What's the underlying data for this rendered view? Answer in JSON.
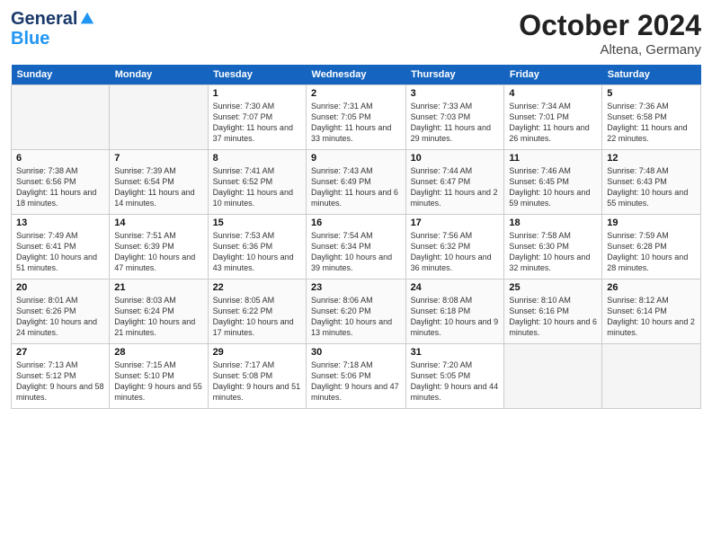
{
  "header": {
    "title": "October 2024",
    "location": "Altena, Germany",
    "logo_line1": "General",
    "logo_line2": "Blue"
  },
  "days_of_week": [
    "Sunday",
    "Monday",
    "Tuesday",
    "Wednesday",
    "Thursday",
    "Friday",
    "Saturday"
  ],
  "weeks": [
    [
      {
        "day": "",
        "empty": true
      },
      {
        "day": "",
        "empty": true
      },
      {
        "day": "1",
        "sunrise": "Sunrise: 7:30 AM",
        "sunset": "Sunset: 7:07 PM",
        "daylight": "Daylight: 11 hours and 37 minutes."
      },
      {
        "day": "2",
        "sunrise": "Sunrise: 7:31 AM",
        "sunset": "Sunset: 7:05 PM",
        "daylight": "Daylight: 11 hours and 33 minutes."
      },
      {
        "day": "3",
        "sunrise": "Sunrise: 7:33 AM",
        "sunset": "Sunset: 7:03 PM",
        "daylight": "Daylight: 11 hours and 29 minutes."
      },
      {
        "day": "4",
        "sunrise": "Sunrise: 7:34 AM",
        "sunset": "Sunset: 7:01 PM",
        "daylight": "Daylight: 11 hours and 26 minutes."
      },
      {
        "day": "5",
        "sunrise": "Sunrise: 7:36 AM",
        "sunset": "Sunset: 6:58 PM",
        "daylight": "Daylight: 11 hours and 22 minutes."
      }
    ],
    [
      {
        "day": "6",
        "sunrise": "Sunrise: 7:38 AM",
        "sunset": "Sunset: 6:56 PM",
        "daylight": "Daylight: 11 hours and 18 minutes."
      },
      {
        "day": "7",
        "sunrise": "Sunrise: 7:39 AM",
        "sunset": "Sunset: 6:54 PM",
        "daylight": "Daylight: 11 hours and 14 minutes."
      },
      {
        "day": "8",
        "sunrise": "Sunrise: 7:41 AM",
        "sunset": "Sunset: 6:52 PM",
        "daylight": "Daylight: 11 hours and 10 minutes."
      },
      {
        "day": "9",
        "sunrise": "Sunrise: 7:43 AM",
        "sunset": "Sunset: 6:49 PM",
        "daylight": "Daylight: 11 hours and 6 minutes."
      },
      {
        "day": "10",
        "sunrise": "Sunrise: 7:44 AM",
        "sunset": "Sunset: 6:47 PM",
        "daylight": "Daylight: 11 hours and 2 minutes."
      },
      {
        "day": "11",
        "sunrise": "Sunrise: 7:46 AM",
        "sunset": "Sunset: 6:45 PM",
        "daylight": "Daylight: 10 hours and 59 minutes."
      },
      {
        "day": "12",
        "sunrise": "Sunrise: 7:48 AM",
        "sunset": "Sunset: 6:43 PM",
        "daylight": "Daylight: 10 hours and 55 minutes."
      }
    ],
    [
      {
        "day": "13",
        "sunrise": "Sunrise: 7:49 AM",
        "sunset": "Sunset: 6:41 PM",
        "daylight": "Daylight: 10 hours and 51 minutes."
      },
      {
        "day": "14",
        "sunrise": "Sunrise: 7:51 AM",
        "sunset": "Sunset: 6:39 PM",
        "daylight": "Daylight: 10 hours and 47 minutes."
      },
      {
        "day": "15",
        "sunrise": "Sunrise: 7:53 AM",
        "sunset": "Sunset: 6:36 PM",
        "daylight": "Daylight: 10 hours and 43 minutes."
      },
      {
        "day": "16",
        "sunrise": "Sunrise: 7:54 AM",
        "sunset": "Sunset: 6:34 PM",
        "daylight": "Daylight: 10 hours and 39 minutes."
      },
      {
        "day": "17",
        "sunrise": "Sunrise: 7:56 AM",
        "sunset": "Sunset: 6:32 PM",
        "daylight": "Daylight: 10 hours and 36 minutes."
      },
      {
        "day": "18",
        "sunrise": "Sunrise: 7:58 AM",
        "sunset": "Sunset: 6:30 PM",
        "daylight": "Daylight: 10 hours and 32 minutes."
      },
      {
        "day": "19",
        "sunrise": "Sunrise: 7:59 AM",
        "sunset": "Sunset: 6:28 PM",
        "daylight": "Daylight: 10 hours and 28 minutes."
      }
    ],
    [
      {
        "day": "20",
        "sunrise": "Sunrise: 8:01 AM",
        "sunset": "Sunset: 6:26 PM",
        "daylight": "Daylight: 10 hours and 24 minutes."
      },
      {
        "day": "21",
        "sunrise": "Sunrise: 8:03 AM",
        "sunset": "Sunset: 6:24 PM",
        "daylight": "Daylight: 10 hours and 21 minutes."
      },
      {
        "day": "22",
        "sunrise": "Sunrise: 8:05 AM",
        "sunset": "Sunset: 6:22 PM",
        "daylight": "Daylight: 10 hours and 17 minutes."
      },
      {
        "day": "23",
        "sunrise": "Sunrise: 8:06 AM",
        "sunset": "Sunset: 6:20 PM",
        "daylight": "Daylight: 10 hours and 13 minutes."
      },
      {
        "day": "24",
        "sunrise": "Sunrise: 8:08 AM",
        "sunset": "Sunset: 6:18 PM",
        "daylight": "Daylight: 10 hours and 9 minutes."
      },
      {
        "day": "25",
        "sunrise": "Sunrise: 8:10 AM",
        "sunset": "Sunset: 6:16 PM",
        "daylight": "Daylight: 10 hours and 6 minutes."
      },
      {
        "day": "26",
        "sunrise": "Sunrise: 8:12 AM",
        "sunset": "Sunset: 6:14 PM",
        "daylight": "Daylight: 10 hours and 2 minutes."
      }
    ],
    [
      {
        "day": "27",
        "sunrise": "Sunrise: 7:13 AM",
        "sunset": "Sunset: 5:12 PM",
        "daylight": "Daylight: 9 hours and 58 minutes."
      },
      {
        "day": "28",
        "sunrise": "Sunrise: 7:15 AM",
        "sunset": "Sunset: 5:10 PM",
        "daylight": "Daylight: 9 hours and 55 minutes."
      },
      {
        "day": "29",
        "sunrise": "Sunrise: 7:17 AM",
        "sunset": "Sunset: 5:08 PM",
        "daylight": "Daylight: 9 hours and 51 minutes."
      },
      {
        "day": "30",
        "sunrise": "Sunrise: 7:18 AM",
        "sunset": "Sunset: 5:06 PM",
        "daylight": "Daylight: 9 hours and 47 minutes."
      },
      {
        "day": "31",
        "sunrise": "Sunrise: 7:20 AM",
        "sunset": "Sunset: 5:05 PM",
        "daylight": "Daylight: 9 hours and 44 minutes."
      },
      {
        "day": "",
        "empty": true
      },
      {
        "day": "",
        "empty": true
      }
    ]
  ]
}
